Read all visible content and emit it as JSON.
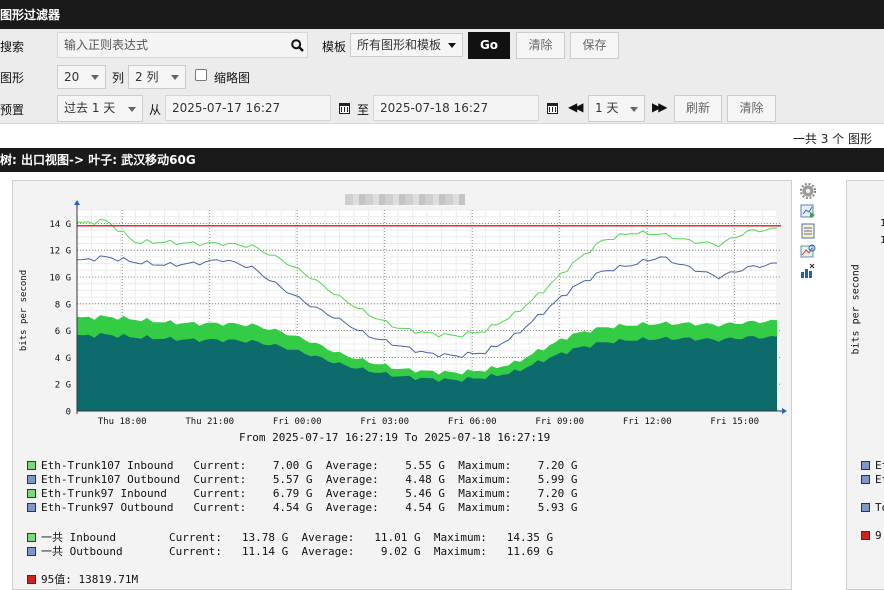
{
  "header": {
    "title": "图形过滤器"
  },
  "filter": {
    "search_label": "搜索",
    "search_placeholder": "输入正则表达式",
    "template_label": "模板",
    "template_value": "所有图形和模板",
    "go_label": "Go",
    "clear_label": "清除",
    "save_label": "保存",
    "graphs_label": "图形",
    "graphs_value": "20",
    "columns_label": "列",
    "columns_value": "2 列",
    "thumbnail_label": "缩略图",
    "preset_label": "预置",
    "preset_value": "过去 1 天",
    "from_label": "从",
    "from_value": "2025-07-17 16:27",
    "to_label": "至",
    "to_value": "2025-07-18 16:27",
    "shift_value": "1 天",
    "refresh_label": "刷新",
    "clear2_label": "清除"
  },
  "summary": {
    "total_text": "一共 3 个 图形"
  },
  "tree": {
    "path": "树: 出口视图-> 叶子: 武汉移动60G"
  },
  "chart_data": {
    "type": "area",
    "title": "",
    "ylabel": "bits per second",
    "ylim": [
      0,
      15
    ],
    "yticks": [
      "0",
      "2 G",
      "4 G",
      "6 G",
      "8 G",
      "10 G",
      "12 G",
      "14 G"
    ],
    "xticks": [
      "Thu 18:00",
      "Thu 21:00",
      "Fri 00:00",
      "Fri 03:00",
      "Fri 06:00",
      "Fri 09:00",
      "Fri 12:00",
      "Fri 15:00"
    ],
    "time_range": "From 2025-07-17 16:27:19 To 2025-07-18 16:27:19",
    "x_hours": [
      0,
      1,
      2,
      3,
      4,
      5,
      6,
      7,
      8,
      9,
      10,
      11,
      12,
      13,
      14,
      15,
      16,
      17,
      18,
      19,
      20,
      21,
      22,
      23,
      24
    ],
    "series": [
      {
        "name": "Eth-Trunk107 Inbound",
        "color": "#2ecc40",
        "values": [
          6.8,
          6.9,
          6.7,
          6.5,
          6.4,
          6.4,
          6.3,
          5.8,
          5.1,
          4.2,
          3.6,
          3.1,
          2.9,
          2.8,
          3.0,
          3.5,
          4.6,
          5.6,
          6.1,
          6.3,
          6.4,
          6.4,
          6.3,
          6.5,
          6.6
        ]
      },
      {
        "name": "Eth-Trunk107 Outbound",
        "color": "#4f6fb0",
        "values": [
          5.6,
          5.7,
          5.5,
          5.4,
          5.3,
          5.3,
          5.2,
          4.8,
          4.2,
          3.5,
          3.0,
          2.6,
          2.4,
          2.3,
          2.5,
          2.9,
          3.8,
          4.6,
          5.1,
          5.3,
          5.4,
          5.4,
          5.3,
          5.5,
          5.5
        ]
      },
      {
        "name": "Eth-Trunk97 Inbound",
        "color": "#6fd16f",
        "values": []
      },
      {
        "name": "Eth-Trunk97 Outbound",
        "color": "#6f86c0",
        "values": []
      },
      {
        "name": "一共 Inbound",
        "color": "#5ad35a",
        "values": [
          14.0,
          14.2,
          12.6,
          12.6,
          12.5,
          12.5,
          12.3,
          11.3,
          10.0,
          8.5,
          7.2,
          6.2,
          5.8,
          5.6,
          6.0,
          7.2,
          9.0,
          11.0,
          12.7,
          13.3,
          13.2,
          12.7,
          12.4,
          13.4,
          13.6
        ]
      },
      {
        "name": "一共 Outbound",
        "color": "#4a62a8",
        "values": [
          11.2,
          11.5,
          11.1,
          10.9,
          11.0,
          11.3,
          10.7,
          9.2,
          7.9,
          6.8,
          5.6,
          4.9,
          4.3,
          4.1,
          4.4,
          5.6,
          7.4,
          9.2,
          10.4,
          10.9,
          11.5,
          10.7,
          10.0,
          10.7,
          11.0
        ]
      }
    ],
    "percentile95": 13.82,
    "percentile_color": "#cc1f1f"
  },
  "legend": {
    "rows": [
      {
        "name": "Eth-Trunk107 Inbound ",
        "color": "#7fd67f",
        "current": "7.00 G",
        "average": "5.55 G",
        "maximum": "7.20 G"
      },
      {
        "name": "Eth-Trunk107 Outbound",
        "color": "#7e96c8",
        "current": "5.57 G",
        "average": "4.48 G",
        "maximum": "5.99 G"
      },
      {
        "name": "Eth-Trunk97 Inbound  ",
        "color": "#7fd67f",
        "current": "6.79 G",
        "average": "5.46 G",
        "maximum": "7.20 G"
      },
      {
        "name": "Eth-Trunk97 Outbound ",
        "color": "#7e96c8",
        "current": "4.54 G",
        "average": "4.54 G",
        "maximum": "5.93 G"
      }
    ],
    "totals": [
      {
        "name": "一共 Inbound   ",
        "color": "#7fd67f",
        "current": "13.78 G",
        "average": "11.01 G",
        "maximum": "14.35 G"
      },
      {
        "name": "一共 Outbound  ",
        "color": "#7e96c8",
        "current": "11.14 G",
        "average": " 9.02 G",
        "maximum": "11.69 G"
      }
    ],
    "current_label": "Current:",
    "average_label": "Average:",
    "maximum_label": "Maximum:",
    "p95": {
      "color": "#cc2222",
      "text": "95值: 13819.71M"
    }
  },
  "second_panel": {
    "ylabel": "bits per second",
    "tick_a": "1",
    "tick_b": "1",
    "legend_a": "Et",
    "legend_b": "Et",
    "legend_c": "To",
    "legend_d": "9."
  },
  "icons": [
    "gear-icon",
    "graph-export-icon",
    "csv-icon",
    "zoom-icon",
    "realtime-icon"
  ]
}
